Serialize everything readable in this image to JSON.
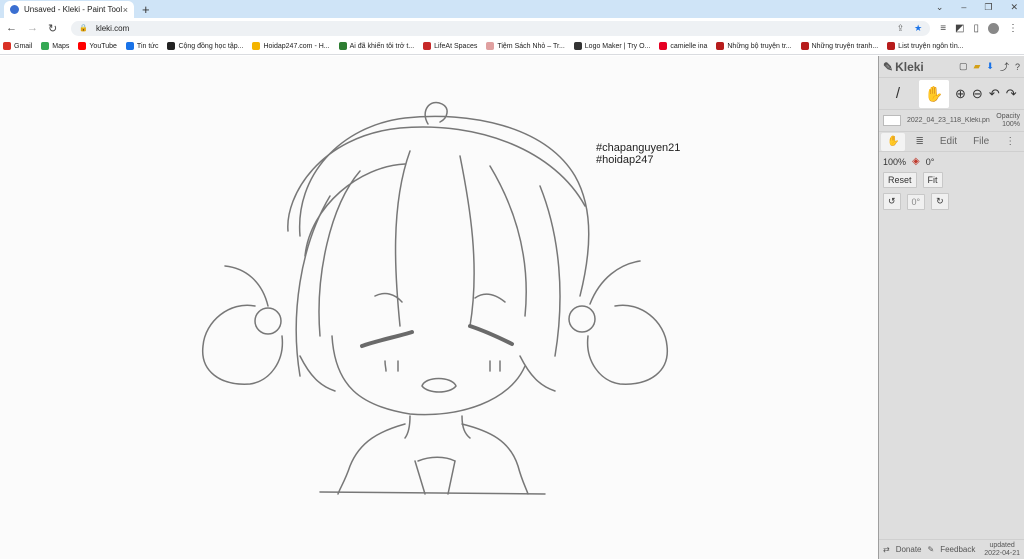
{
  "browser": {
    "tab_title": "Unsaved - Kleki - Paint Tool",
    "tab_close": "×",
    "new_tab": "+",
    "url": "kleki.com",
    "window_controls": [
      "⌄",
      "–",
      "❐",
      "✕"
    ]
  },
  "bookmarks": [
    {
      "label": "Gmail",
      "color": "#d93025"
    },
    {
      "label": "Maps",
      "color": "#34a853"
    },
    {
      "label": "YouTube",
      "color": "#ff0000"
    },
    {
      "label": "Tin tức",
      "color": "#1a73e8"
    },
    {
      "label": "Cộng đồng học tập...",
      "color": "#222222"
    },
    {
      "label": "Hoidap247.com - H...",
      "color": "#f4b400"
    },
    {
      "label": "Ai đã khiến tôi trở t...",
      "color": "#2e7d32"
    },
    {
      "label": "LifeAt Spaces",
      "color": "#c62828"
    },
    {
      "label": "Tiệm Sách Nhỏ – Tr...",
      "color": "#e0a0a0"
    },
    {
      "label": "Logo Maker | Try O...",
      "color": "#333333"
    },
    {
      "label": "camielle ina",
      "color": "#e60023"
    },
    {
      "label": "Những bộ truyện tr...",
      "color": "#b71c1c"
    },
    {
      "label": "Những truyện tranh...",
      "color": "#b71c1c"
    },
    {
      "label": "List truyện ngôn tìn...",
      "color": "#b71c1c"
    }
  ],
  "canvas": {
    "hashtag1": "#chapanguyen21",
    "hashtag2": "#hoidap247"
  },
  "panel": {
    "brand": "Kleki",
    "file_name": "2022_04_23_118_Kleki.png",
    "opacity_label": "Opacity",
    "opacity_value": "100%",
    "tabs": [
      "Edit",
      "File"
    ],
    "zoom": "100%",
    "rotation": "0°",
    "reset_label": "Reset",
    "fit_label": "Fit",
    "rotate_value": "0°",
    "donate_label": "Donate",
    "feedback_label": "Feedback",
    "updated_label": "updated",
    "updated_date": "2022-04-21"
  }
}
